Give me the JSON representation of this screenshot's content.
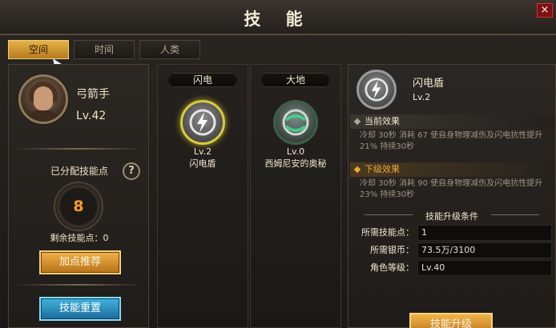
{
  "window": {
    "title": "技 能",
    "close_symbol": "×"
  },
  "tabs": [
    {
      "label": "空间",
      "active": true
    },
    {
      "label": "时间",
      "active": false
    },
    {
      "label": "人类",
      "active": false
    }
  ],
  "character": {
    "name": "弓箭手",
    "level": "Lv.42",
    "assigned_label": "已分配技能点",
    "assigned_points": "8",
    "remaining_label": "剩余技能点：0",
    "help_symbol": "?",
    "recommend_button": "加点推荐",
    "reset_button": "技能重置"
  },
  "columns": [
    {
      "header": "闪电",
      "skill": {
        "level": "Lv.2",
        "name": "闪电盾",
        "icon": "lightning-icon",
        "selected": true
      }
    },
    {
      "header": "大地",
      "skill": {
        "level": "Lv.0",
        "name": "西姆尼安的奥秘",
        "icon": "earth-icon",
        "selected": false
      }
    }
  ],
  "detail": {
    "name": "闪电盾",
    "level": "Lv.2",
    "current_label": "当前效果",
    "current_text": "冷却 30秒  消耗 67 使自身物理减伤及闪电抗性提升21% 持续30秒",
    "next_label": "下级效果",
    "next_text": "冷却 30秒  消耗 90 使自身物理减伤及闪电抗性提升23% 持续30秒",
    "upgrade_title": "技能升级条件",
    "requirements": [
      {
        "label": "所需技能点：",
        "value": "1",
        "color": "#ff3b2e"
      },
      {
        "label": "所需银币：",
        "value": "73.5万/3100",
        "color": "#6edd6a"
      },
      {
        "label": "角色等级：",
        "value": "Lv.40",
        "color": "#6edd6a"
      }
    ],
    "upgrade_button": "技能升级"
  }
}
